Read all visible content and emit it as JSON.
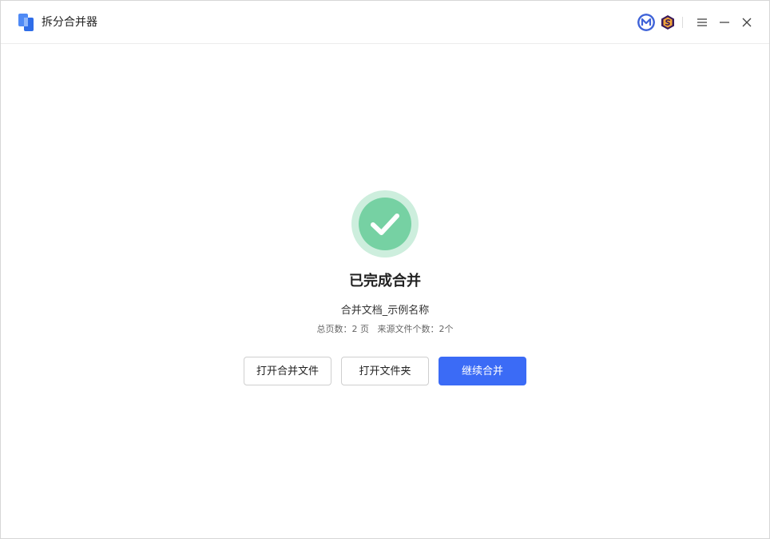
{
  "app": {
    "title": "拆分合并器"
  },
  "result": {
    "title": "已完成合并",
    "file_name": "合并文档_示例名称",
    "total_pages_label": "总页数：",
    "total_pages_value": "2 页",
    "source_count_label": "来源文件个数：",
    "source_count_value": "2个"
  },
  "buttons": {
    "open_merged_file": "打开合并文件",
    "open_folder": "打开文件夹",
    "continue_merge": "继续合并"
  },
  "colors": {
    "primary": "#3b6bf6",
    "success": "#76d1a3",
    "success_ring": "#cdeedd"
  }
}
